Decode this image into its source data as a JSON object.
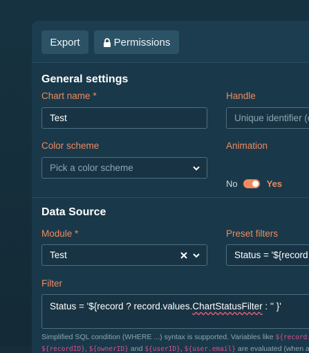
{
  "toolbar": {
    "export_label": "Export",
    "permissions_label": "Permissions"
  },
  "general": {
    "title": "General settings",
    "chart_name_label": "Chart name",
    "chart_name_value": "Test",
    "handle_label": "Handle",
    "handle_placeholder": "Unique identifier (c",
    "color_scheme_label": "Color scheme",
    "color_scheme_placeholder": "Pick a color scheme",
    "animation_label": "Animation",
    "animation_off": "No",
    "animation_on": "Yes",
    "animation_enabled": true
  },
  "data_source": {
    "title": "Data Source",
    "module_label": "Module",
    "module_value": "Test",
    "preset_filters_label": "Preset filters",
    "preset_filters_value": "Status = '${record",
    "filter_label": "Filter",
    "filter_value_prefix": "Status = '${record ? record.values.",
    "filter_value_highlight": "ChartStatusFilter",
    "filter_value_suffix": " : '' }'",
    "help_text_1": "Simplified SQL condition (WHERE ...) syntax is supported. Variables like ",
    "help_code_1": "${record.va",
    "help_code_2": "${recordID}",
    "help_code_3": "${ownerID}",
    "help_text_2": " and ",
    "help_code_4": "${userID}",
    "help_code_5": "${user.email}",
    "help_text_3": " are evaluated (when availa"
  },
  "required_marker": "*",
  "colors": {
    "accent": "#f0895f",
    "background": "#19394a",
    "button": "#2c5266"
  }
}
